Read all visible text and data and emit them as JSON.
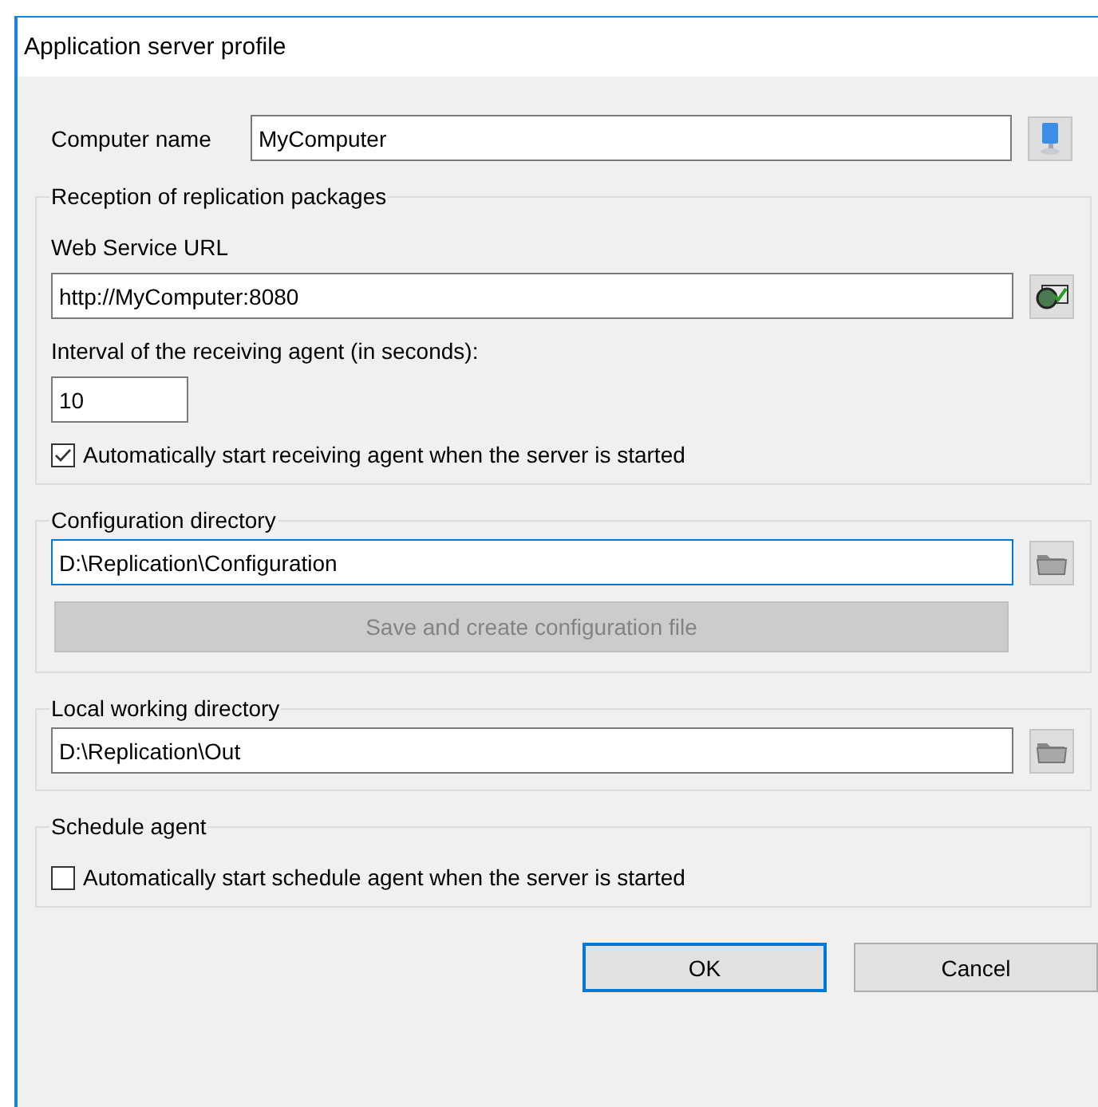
{
  "window": {
    "title": "Application server profile"
  },
  "computer_name": {
    "label": "Computer name",
    "value": "MyComputer"
  },
  "reception": {
    "title": "Reception of replication packages",
    "url_label": "Web Service URL",
    "url_value": "http://MyComputer:8080",
    "interval_label": "Interval of the receiving agent (in seconds):",
    "interval_value": "10",
    "autostart": {
      "label": "Automatically start receiving agent when the server is started",
      "checked": true
    }
  },
  "configuration": {
    "title": "Configuration directory",
    "path": "D:\\Replication\\Configuration",
    "focused": true,
    "save_button": {
      "label": "Save and create configuration file",
      "disabled": true
    }
  },
  "local": {
    "title": "Local working directory",
    "path": "D:\\Replication\\Out",
    "focused": false
  },
  "schedule": {
    "title": "Schedule agent",
    "autostart": {
      "label": "Automatically start schedule agent when the server is started",
      "checked": false
    }
  },
  "buttons": [
    {
      "label": "OK",
      "default": true
    },
    {
      "label": "Cancel",
      "default": false
    }
  ]
}
